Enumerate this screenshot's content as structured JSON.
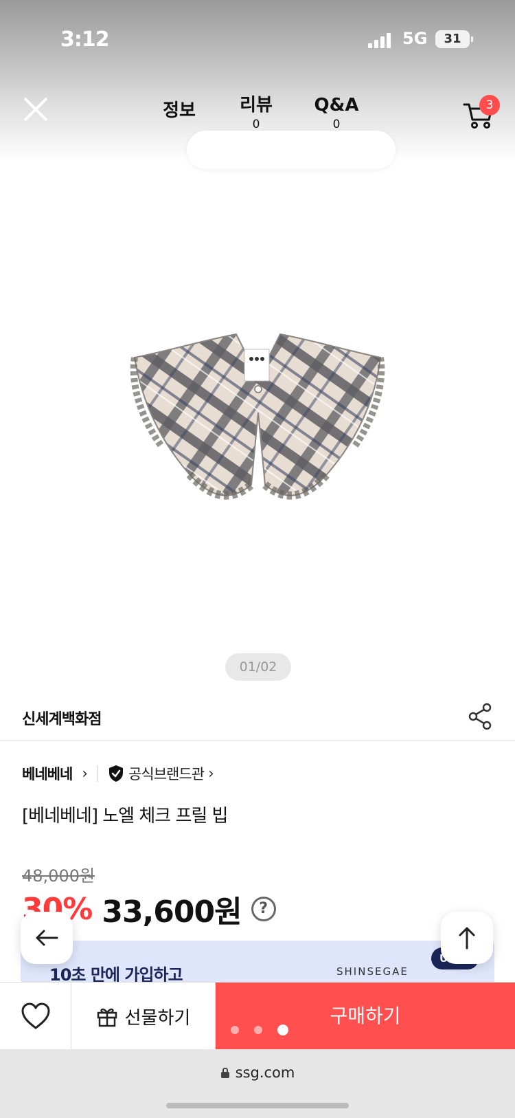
{
  "status_bar": {
    "time": "3:12",
    "network": "5G",
    "battery": "31"
  },
  "nav": {
    "tabs": [
      {
        "label": "정보",
        "count": ""
      },
      {
        "label": "리뷰",
        "count": "0"
      },
      {
        "label": "Q&A",
        "count": "0"
      }
    ],
    "cart_badge": "3"
  },
  "gallery": {
    "counter": "01/02"
  },
  "seller": {
    "name": "신세계백화점"
  },
  "product": {
    "brand": "베네베네",
    "official_label": "공식브랜드관",
    "title": "[베네베네] 노엘 체크 프릴 빕",
    "original_price": "48,000원",
    "discount": "30%",
    "sale_price": "33,600원"
  },
  "banner": {
    "text": "10초 만에 가입하고",
    "brand": "SHINSEGAE",
    "tag": "U 클럽"
  },
  "bottom_bar": {
    "gift_label": "선물하기",
    "buy_label": "구매하기"
  },
  "browser": {
    "url": "ssg.com"
  },
  "colors": {
    "accent": "#ff4f4f",
    "discount": "#ff3b3b",
    "banner_bg": "#dfe6fb",
    "banner_navy": "#1b2659"
  }
}
